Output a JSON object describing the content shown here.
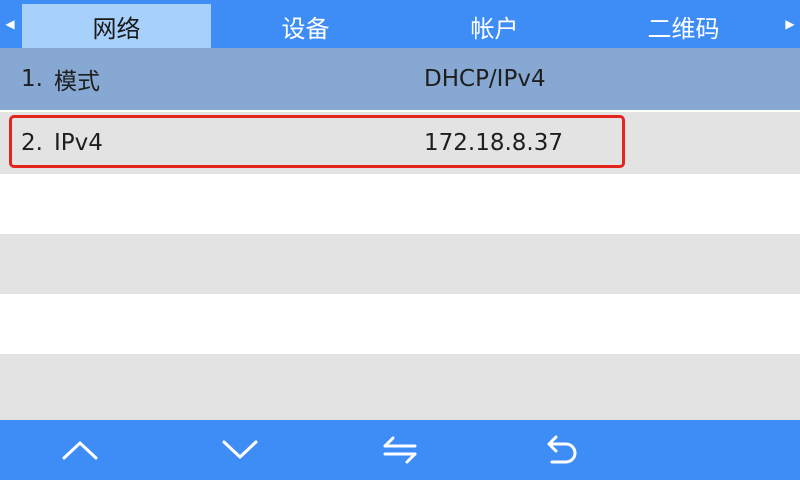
{
  "tabs": [
    {
      "label": "网络",
      "active": true
    },
    {
      "label": "设备",
      "active": false
    },
    {
      "label": "帐户",
      "active": false
    },
    {
      "label": "二维码",
      "active": false
    }
  ],
  "nav": {
    "left_arrow": "◀",
    "right_arrow": "▶"
  },
  "rows": [
    {
      "num": "1.",
      "label": "模式",
      "value": "DHCP/IPv4"
    },
    {
      "num": "2.",
      "label": "IPv4",
      "value": "172.18.8.37"
    }
  ],
  "bottom_bar": {
    "buttons": [
      {
        "icon": "chevron-up-icon"
      },
      {
        "icon": "chevron-down-icon"
      },
      {
        "icon": "switch-arrows-icon"
      },
      {
        "icon": "back-return-icon"
      }
    ]
  },
  "colors": {
    "accent": "#3e8df7",
    "active_tab": "#a7d0fb",
    "selected_row": "#86a8d2",
    "alt_row": "#e3e3e3",
    "highlight_border": "#e3241f"
  }
}
